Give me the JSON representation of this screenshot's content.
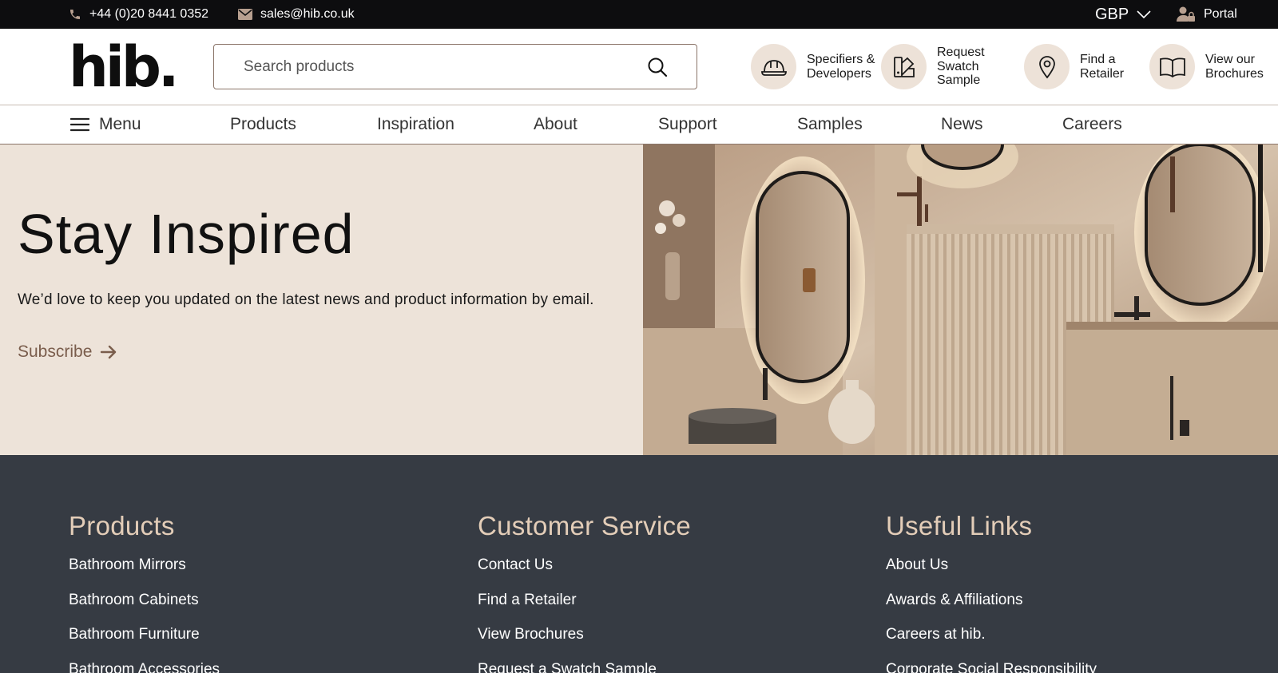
{
  "topbar": {
    "phone": "+44 (0)20 8441 0352",
    "email": "sales@hib.co.uk",
    "currency": "GBP",
    "portal": "Portal"
  },
  "header": {
    "logo": "hib.",
    "search_placeholder": "Search products",
    "quick_links": [
      {
        "label": "Specifiers &\nDevelopers",
        "icon": "hard-hat-icon"
      },
      {
        "label": "Request\nSwatch\nSample",
        "icon": "swatch-icon"
      },
      {
        "label": "Find a\nRetailer",
        "icon": "location-pin-icon"
      },
      {
        "label": "View our\nBrochures",
        "icon": "book-icon"
      }
    ]
  },
  "nav": {
    "menu": "Menu",
    "items": [
      "Products",
      "Inspiration",
      "About",
      "Support",
      "Samples",
      "News",
      "Careers"
    ]
  },
  "hero": {
    "title": "Stay Inspired",
    "text": "We’d love to keep you updated on the latest news and product information by email.",
    "cta": "Subscribe"
  },
  "footer": {
    "columns": [
      {
        "title": "Products",
        "links": [
          "Bathroom Mirrors",
          "Bathroom Cabinets",
          "Bathroom Furniture",
          "Bathroom Accessories"
        ]
      },
      {
        "title": "Customer Service",
        "links": [
          "Contact Us",
          "Find a Retailer",
          "View Brochures",
          "Request a Swatch Sample"
        ]
      },
      {
        "title": "Useful Links",
        "links": [
          "About Us",
          "Awards & Affiliations",
          "Careers at hib.",
          "Corporate Social Responsibility"
        ]
      }
    ]
  },
  "colors": {
    "topbar_bg": "#0d0d0f",
    "hero_bg": "#ede3d9",
    "accent_brown": "#7a5d4c",
    "footer_bg": "#363b43",
    "footer_heading": "#e3cdb8",
    "icon_circle": "#ede2d8"
  }
}
